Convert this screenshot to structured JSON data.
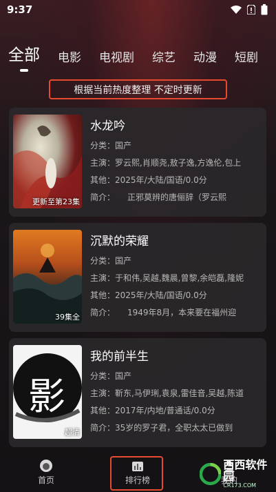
{
  "status_bar": {
    "time": "9:37"
  },
  "tabs": [
    "全部",
    "电影",
    "电视剧",
    "综艺",
    "动漫",
    "短剧"
  ],
  "notice": "根据当前热度整理 不定时更新",
  "items": [
    {
      "title": "水龙吟",
      "badge": "更新至第23集",
      "category": "分类：国产",
      "cast": "主演：罗云熙,肖顺尧,敖子逸,方逸伦,包上",
      "other": "其他：2025年/大陆/国语/0.0分",
      "intro": "简介：　　正邪莫辨的唐俪辞（罗云熙"
    },
    {
      "title": "沉默的荣耀",
      "badge": "39集全",
      "category": "分类：国产",
      "cast": "主演：于和伟,吴越,魏晨,曾黎,余皑磊,隆妮",
      "other": "其他：2025年/大陆/国语/0.0分",
      "intro": "简介：　　1949年8月，本来要在福州迎"
    },
    {
      "title": "我的前半生",
      "badge": "超清",
      "category": "分类：国产",
      "cast": "主演：靳东,马伊琍,袁泉,雷佳音,吴越,陈道",
      "other": "其他：2017年/内地/普通话/0.0分",
      "intro": "简介：35岁的罗子君，全职太太已做到"
    }
  ],
  "poster_art": {
    "third_char": "影"
  },
  "bottom_nav": {
    "home": "首页",
    "rank": "排行榜",
    "mine": "我的"
  },
  "watermark": {
    "main": "西西软件园",
    "sub": "CR173.COM"
  },
  "colors": {
    "highlight": "#e84a2f",
    "card_bg": "#2a282a",
    "watermark_green": "#2aa84a"
  }
}
